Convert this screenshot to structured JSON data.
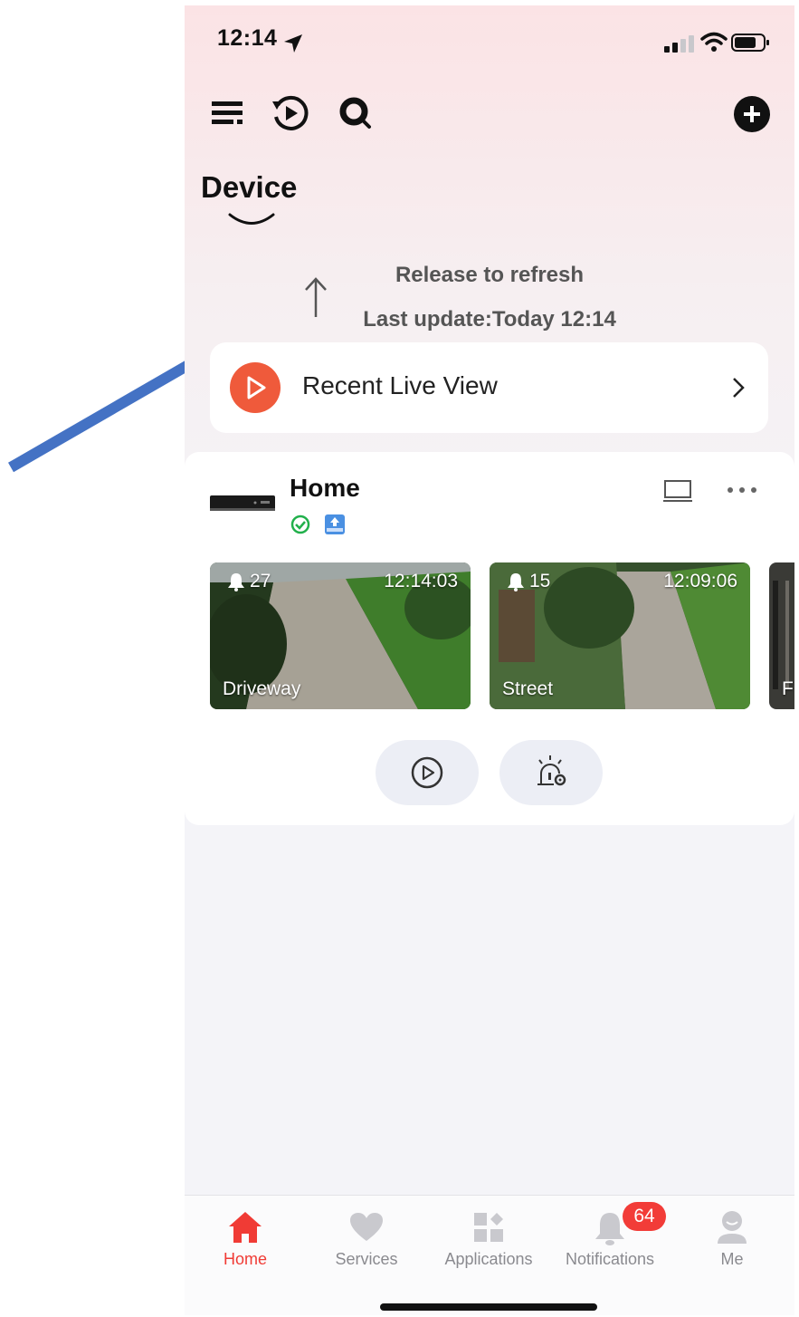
{
  "status_bar": {
    "time": "12:14"
  },
  "header": {
    "title": "Device"
  },
  "refresh": {
    "release_text": "Release to refresh",
    "last_update": "Last update:Today 12:14"
  },
  "recent_live": {
    "label": "Recent Live View"
  },
  "device_card": {
    "name": "Home",
    "cameras": [
      {
        "name": "Driveway",
        "alerts": "27",
        "time": "12:14:03"
      },
      {
        "name": "Street",
        "alerts": "15",
        "time": "12:09:06"
      },
      {
        "name": "F"
      }
    ]
  },
  "tabbar": {
    "tabs": [
      {
        "label": "Home",
        "active": true
      },
      {
        "label": "Services"
      },
      {
        "label": "Applications"
      },
      {
        "label": "Notifications",
        "badge": "64"
      },
      {
        "label": "Me"
      }
    ]
  },
  "colors": {
    "accent": "#f03b35",
    "live_button": "#ef5a3b",
    "annotation_arrow": "#4472c4",
    "online": "#21b04b"
  },
  "icons": [
    "location-arrow-icon",
    "signal-icon",
    "wifi-icon",
    "battery-icon",
    "menu-list-icon",
    "playback-icon",
    "search-icon",
    "add-icon",
    "smile-chevron-icon",
    "up-arrow-icon",
    "play-icon",
    "chevron-right-icon",
    "nvr-device-icon",
    "online-check-icon",
    "cloud-upload-icon",
    "screen-icon",
    "more-icon",
    "bell-icon",
    "alarm-settings-icon",
    "home-icon",
    "heart-icon",
    "apps-icon",
    "notification-bell-icon",
    "profile-icon"
  ]
}
